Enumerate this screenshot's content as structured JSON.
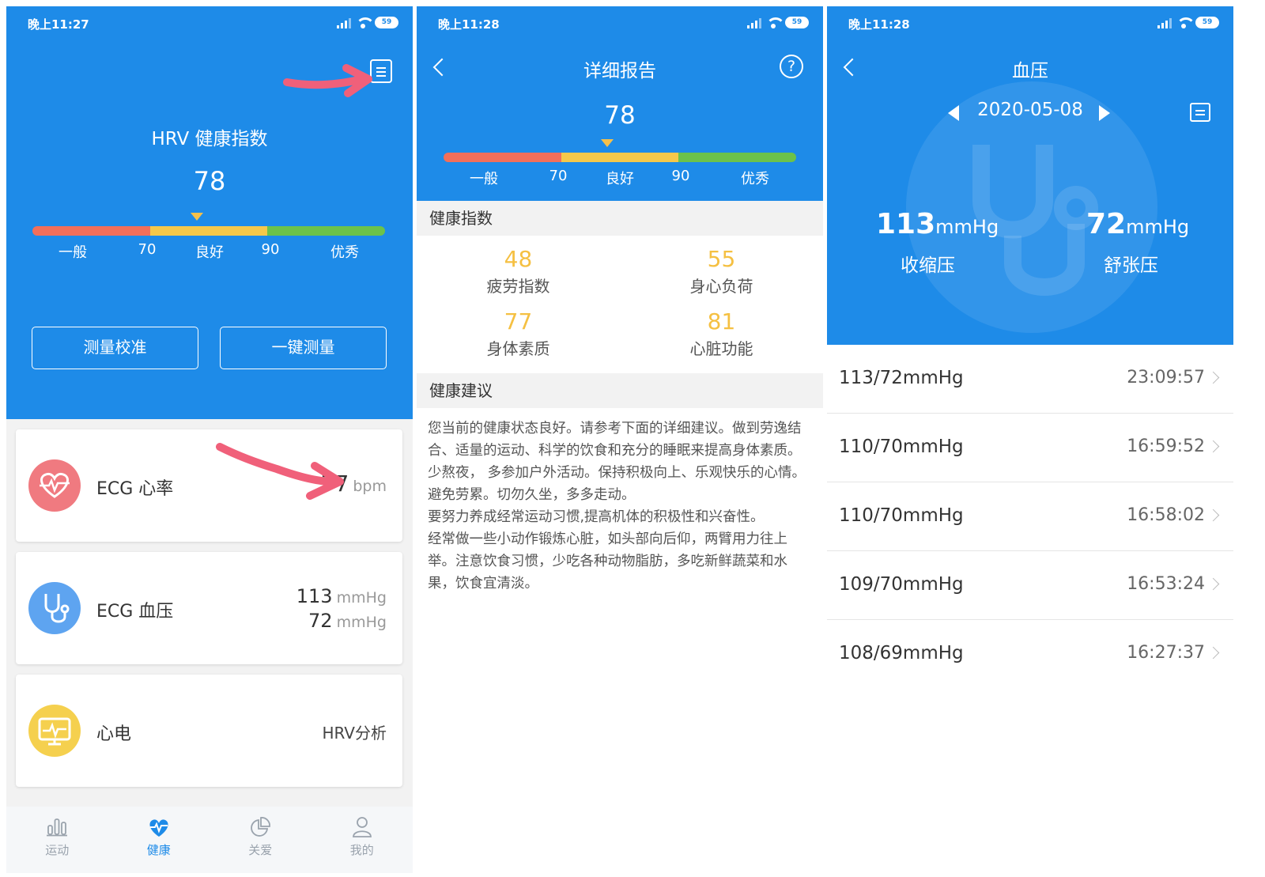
{
  "screen1": {
    "status_time": "晚上11:27",
    "battery": "59",
    "title": "HRV 健康指数",
    "score": "78",
    "gauge": {
      "labels": [
        "一般",
        "70",
        "良好",
        "90",
        "优秀"
      ],
      "value": 78
    },
    "btn_calibrate": "测量校准",
    "btn_measure": "一键测量",
    "cards": [
      {
        "title": "ECG 心率",
        "value": "77",
        "unit": "bpm",
        "icon": "heart-rate-icon",
        "color": "#f07a80"
      },
      {
        "title": "ECG 血压",
        "value1": "113",
        "unit1": "mmHg",
        "value2": "72",
        "unit2": "mmHg",
        "icon": "stethoscope-icon",
        "color": "#5ea4f0"
      },
      {
        "title": "心电",
        "value": "HRV分析",
        "icon": "ecg-monitor-icon",
        "color": "#f5d04e"
      }
    ],
    "tabs": [
      {
        "label": "运动",
        "icon": "bar-chart-icon"
      },
      {
        "label": "健康",
        "icon": "heart-pulse-icon",
        "active": true
      },
      {
        "label": "关爱",
        "icon": "pie-chart-icon"
      },
      {
        "label": "我的",
        "icon": "user-icon"
      }
    ]
  },
  "screen2": {
    "status_time": "晚上11:28",
    "battery": "59",
    "title": "详细报告",
    "score": "78",
    "gauge": {
      "labels": [
        "一般",
        "70",
        "良好",
        "90",
        "优秀"
      ],
      "value": 78
    },
    "section_index": "健康指数",
    "metrics": [
      {
        "value": "48",
        "label": "疲劳指数"
      },
      {
        "value": "55",
        "label": "身心负荷"
      },
      {
        "value": "77",
        "label": "身体素质"
      },
      {
        "value": "81",
        "label": "心脏功能"
      }
    ],
    "section_advice": "健康建议",
    "advice": [
      "您当前的健康状态良好。请参考下面的详细建议。做到劳逸结合、适量的运动、科学的饮食和充分的睡眠来提高身体素质。",
      "少熬夜， 多参加户外活动。保持积极向上、乐观快乐的心情。",
      "避免劳累。切勿久坐，多多走动。",
      "要努力养成经常运动习惯,提高机体的积极性和兴奋性。",
      "经常做一些小动作锻炼心脏，如头部向后仰，两臂用力往上举。注意饮食习惯，少吃各种动物脂肪，多吃新鲜蔬菜和水果，饮食宜清淡。"
    ]
  },
  "screen3": {
    "status_time": "晚上11:28",
    "battery": "59",
    "title": "血压",
    "date": "2020-05-08",
    "systolic": "113",
    "diastolic": "72",
    "unit": "mmHg",
    "systolic_label": "收缩压",
    "diastolic_label": "舒张压",
    "records": [
      {
        "value": "113/72mmHg",
        "time": "23:09:57"
      },
      {
        "value": "110/70mmHg",
        "time": "16:59:52"
      },
      {
        "value": "110/70mmHg",
        "time": "16:58:02"
      },
      {
        "value": "109/70mmHg",
        "time": "16:53:24"
      },
      {
        "value": "108/69mmHg",
        "time": "16:27:37"
      }
    ]
  },
  "colors": {
    "brand_blue": "#1e8be8",
    "annotation_red": "#f0607a",
    "metric_yellow": "#f5c042"
  }
}
